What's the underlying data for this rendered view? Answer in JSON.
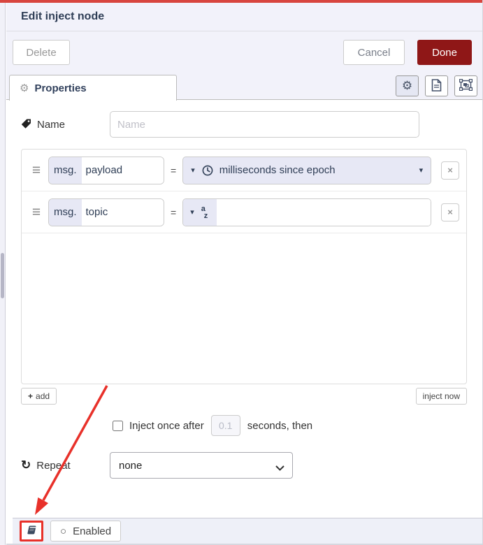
{
  "dialog": {
    "title": "Edit inject node",
    "buttons": {
      "delete": "Delete",
      "cancel": "Cancel",
      "done": "Done"
    },
    "tab": {
      "label": "Properties"
    }
  },
  "name_row": {
    "label": "Name",
    "placeholder": "Name"
  },
  "properties_list": {
    "rows": [
      {
        "prefix": "msg.",
        "key": "payload",
        "equals": "=",
        "type": "timestamp",
        "type_label": "milliseconds since epoch"
      },
      {
        "prefix": "msg.",
        "key": "topic",
        "equals": "=",
        "type": "string",
        "type_label": ""
      }
    ],
    "add_button": "add",
    "inject_now_button": "inject now"
  },
  "inject_once": {
    "checkbox_checked": false,
    "label_before": "Inject once after",
    "delay_value": "0.1",
    "label_after": "seconds, then"
  },
  "repeat": {
    "label": "Repeat",
    "selected_option": "none"
  },
  "footer": {
    "enabled_button": "Enabled"
  },
  "icons": {
    "gear": "⚙",
    "drag_handle": "≡",
    "caret_down": "▾",
    "remove": "×",
    "plus": "+",
    "repeat": "↻",
    "circle": "○",
    "string_a": "a",
    "string_z": "z"
  },
  "colors": {
    "topbar_red": "#d8453e",
    "annotation_red": "#e8312a",
    "done_button_bg": "#8f1717",
    "header_bg": "#f2f2fa",
    "typed_input_bg": "#e7e8f5",
    "title_text": "#2f3e56"
  }
}
